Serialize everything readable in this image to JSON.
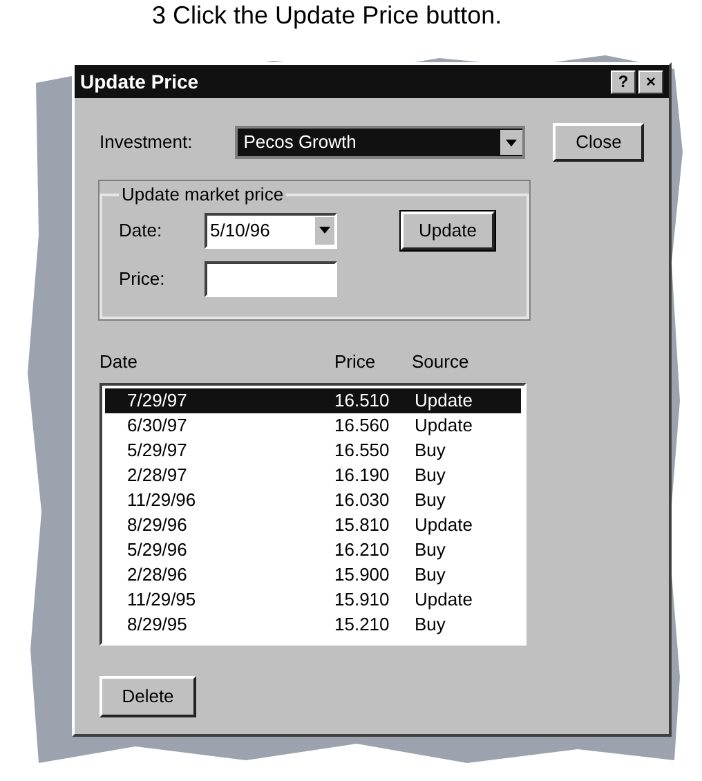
{
  "caption": "3 Click the Update Price button.",
  "dialog": {
    "title": "Update Price",
    "title_buttons": [
      "?",
      "×"
    ],
    "investment": {
      "label": "Investment:",
      "value": "Pecos Growth"
    },
    "close_button": "Close",
    "group": {
      "title": "Update market price",
      "date_label": "Date:",
      "date_value": "5/10/96",
      "price_label": "Price:",
      "update_button": "Update"
    },
    "columns": [
      "Date",
      "Price",
      "Source"
    ],
    "rows": [
      {
        "date": "7/29/97",
        "price": "16.510",
        "source": "Update",
        "selected": true
      },
      {
        "date": "6/30/97",
        "price": "16.560",
        "source": "Update",
        "selected": false
      },
      {
        "date": "5/29/97",
        "price": "16.550",
        "source": "Buy",
        "selected": false
      },
      {
        "date": "2/28/97",
        "price": "16.190",
        "source": "Buy",
        "selected": false
      },
      {
        "date": "11/29/96",
        "price": "16.030",
        "source": "Buy",
        "selected": false
      },
      {
        "date": "8/29/96",
        "price": "15.810",
        "source": "Update",
        "selected": false
      },
      {
        "date": "5/29/96",
        "price": "16.210",
        "source": "Buy",
        "selected": false
      },
      {
        "date": "2/28/96",
        "price": "15.900",
        "source": "Buy",
        "selected": false
      },
      {
        "date": "11/29/95",
        "price": "15.910",
        "source": "Update",
        "selected": false
      },
      {
        "date": "8/29/95",
        "price": "15.210",
        "source": "Buy",
        "selected": false
      }
    ],
    "delete_button": "Delete"
  }
}
